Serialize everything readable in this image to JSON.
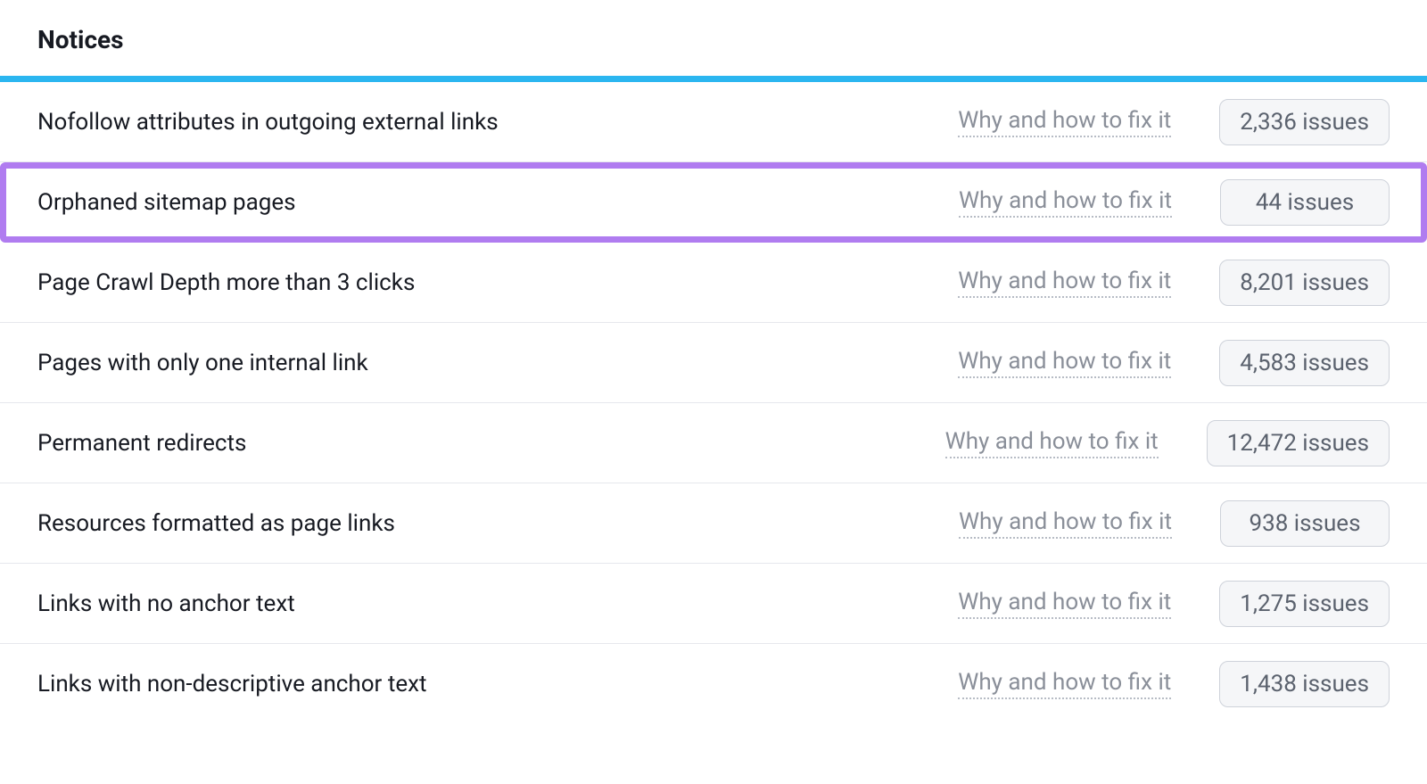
{
  "section_title": "Notices",
  "fix_label": "Why and how to fix it",
  "issues_suffix": " issues",
  "rows": [
    {
      "title": "Nofollow attributes in outgoing external links",
      "issues": "2,336",
      "highlight": false
    },
    {
      "title": "Orphaned sitemap pages",
      "issues": "44",
      "highlight": true
    },
    {
      "title": "Page Crawl Depth more than 3 clicks",
      "issues": "8,201",
      "highlight": false
    },
    {
      "title": "Pages with only one internal link",
      "issues": "4,583",
      "highlight": false
    },
    {
      "title": "Permanent redirects",
      "issues": "12,472",
      "highlight": false
    },
    {
      "title": "Resources formatted as page links",
      "issues": "938",
      "highlight": false
    },
    {
      "title": "Links with no anchor text",
      "issues": "1,275",
      "highlight": false
    },
    {
      "title": "Links with non-descriptive anchor text",
      "issues": "1,438",
      "highlight": false
    }
  ]
}
